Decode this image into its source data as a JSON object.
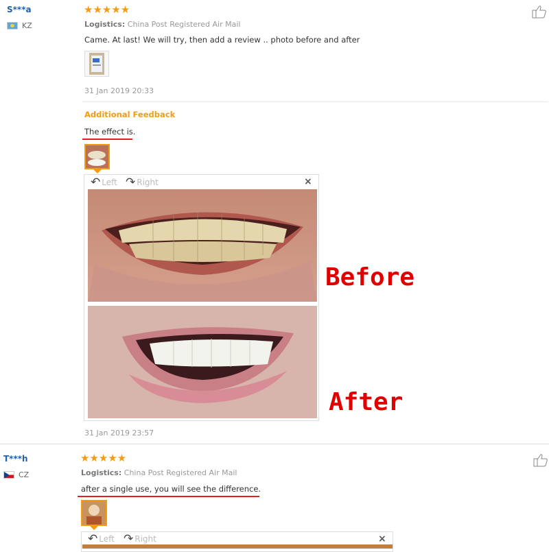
{
  "reviews": [
    {
      "user": "S***a",
      "country": "KZ",
      "stars": "★★★★★",
      "logistics_label": "Logistics:",
      "logistics_value": "China Post Registered Air Mail",
      "text": "Came. At last! We will try, then add a review .. photo before and after",
      "date": "31 Jan 2019 20:33",
      "additional_feedback_title": "Additional Feedback",
      "additional_text": "The effect is.",
      "additional_date": "31 Jan 2019 23:57",
      "viewer": {
        "left": "Left",
        "right": "Right",
        "close": "×"
      },
      "annotations": {
        "before": "Before",
        "after": "After"
      }
    },
    {
      "user": "T***h",
      "country": "CZ",
      "stars": "★★★★★",
      "logistics_label": "Logistics:",
      "logistics_value": "China Post Registered Air Mail",
      "text": "after a single use, you will see the difference.",
      "viewer": {
        "left": "Left",
        "right": "Right",
        "close": "×"
      }
    }
  ],
  "colors": {
    "accent": "#f39c12",
    "user": "#2261a8",
    "annotation": "#e00000"
  }
}
